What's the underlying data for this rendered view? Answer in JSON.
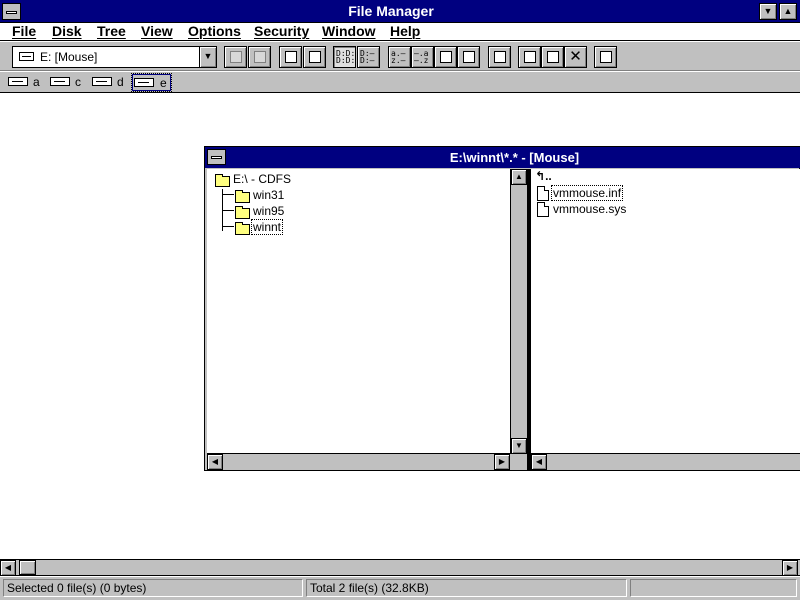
{
  "window": {
    "title": "File Manager"
  },
  "menu": [
    "File",
    "Disk",
    "Tree",
    "View",
    "Options",
    "Security",
    "Window",
    "Help"
  ],
  "toolbar": {
    "drive_combo_value": "E: [Mouse]",
    "buttons": [
      "connect-drive",
      "disconnect-drive",
      "share-as",
      "stop-sharing",
      "view-name",
      "view-all-details",
      "sort-by-name",
      "sort-by-type",
      "sort-by-size",
      "sort-by-date",
      "new-window",
      "copy",
      "move",
      "delete",
      "permissions"
    ]
  },
  "drives": [
    {
      "letter": "a",
      "type": "floppy"
    },
    {
      "letter": "c",
      "type": "hard-disk"
    },
    {
      "letter": "d",
      "type": "hard-disk"
    },
    {
      "letter": "e",
      "type": "cdrom",
      "selected": true
    }
  ],
  "child_window": {
    "title": "E:\\winnt\\*.* - [Mouse]",
    "tree": {
      "root": "E:\\ - CDFS",
      "folders": [
        {
          "name": "win31",
          "selected": false
        },
        {
          "name": "win95",
          "selected": false
        },
        {
          "name": "winnt",
          "selected": true
        }
      ]
    },
    "files": {
      "up_label": "..",
      "items": [
        "vmmouse.inf",
        "vmmouse.sys"
      ]
    }
  },
  "status": {
    "selected": "Selected 0 file(s) (0 bytes)",
    "total": "Total 2 file(s) (32.8KB)"
  }
}
